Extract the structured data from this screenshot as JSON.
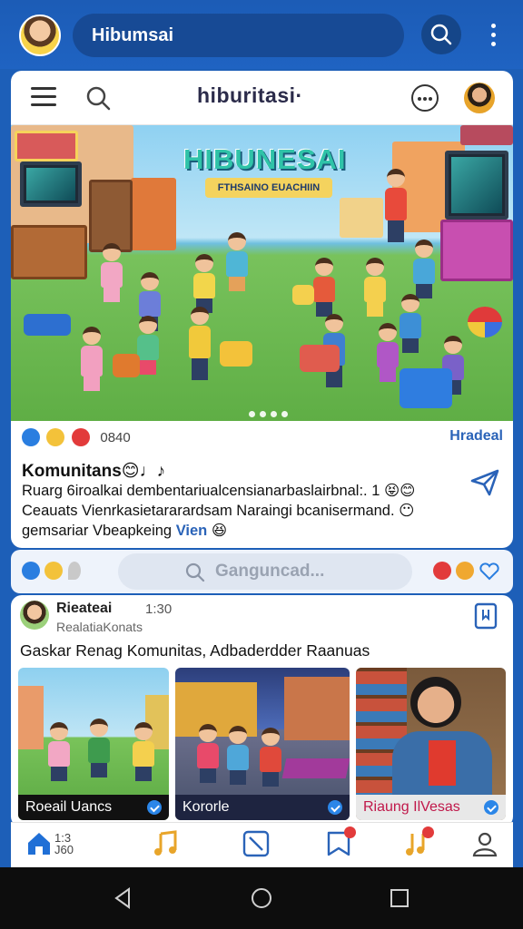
{
  "topbar": {
    "search_label": "Hibumsai"
  },
  "card_header": {
    "title": "hiburitasi·"
  },
  "hero": {
    "title": "HIBUNESAI",
    "subtitle": "FTHSAINO EUACHIIN"
  },
  "post": {
    "reaction_count": "0840",
    "action_label": "Hradeal",
    "title": "Komunitans",
    "title_emoji": "😊♩♪",
    "body_line1": "Ruarg 6iroalkai dembentariualcensianarbaslairbnal:. 1 😝😊",
    "body_line2": "Ceauats Vienrkasietararardsam Naraingi bcanisermand. 😶",
    "body_line3_text": "gemsariar Vbeapkeing ",
    "body_line3_highlight": "Vien",
    "body_line3_emoji": "😆"
  },
  "strip": {
    "search_placeholder": "Ganguncad..."
  },
  "post2": {
    "author": "Rieateai",
    "time": "1:30",
    "subtitle": "RealatiaKonats",
    "text": "Gaskar Renag Komunitas, Adbaderdder Raanuas",
    "thumbnails": [
      {
        "label": "Roeail Uancs"
      },
      {
        "label": "Kororle"
      },
      {
        "label": "Riaung IlVesas"
      }
    ]
  },
  "tabbar": {
    "count_line1": "1:3",
    "count_line2": "J60"
  },
  "colors": {
    "primary": "#1d5fb8",
    "accent": "#2a63b8",
    "badge": "#e23b3b"
  }
}
